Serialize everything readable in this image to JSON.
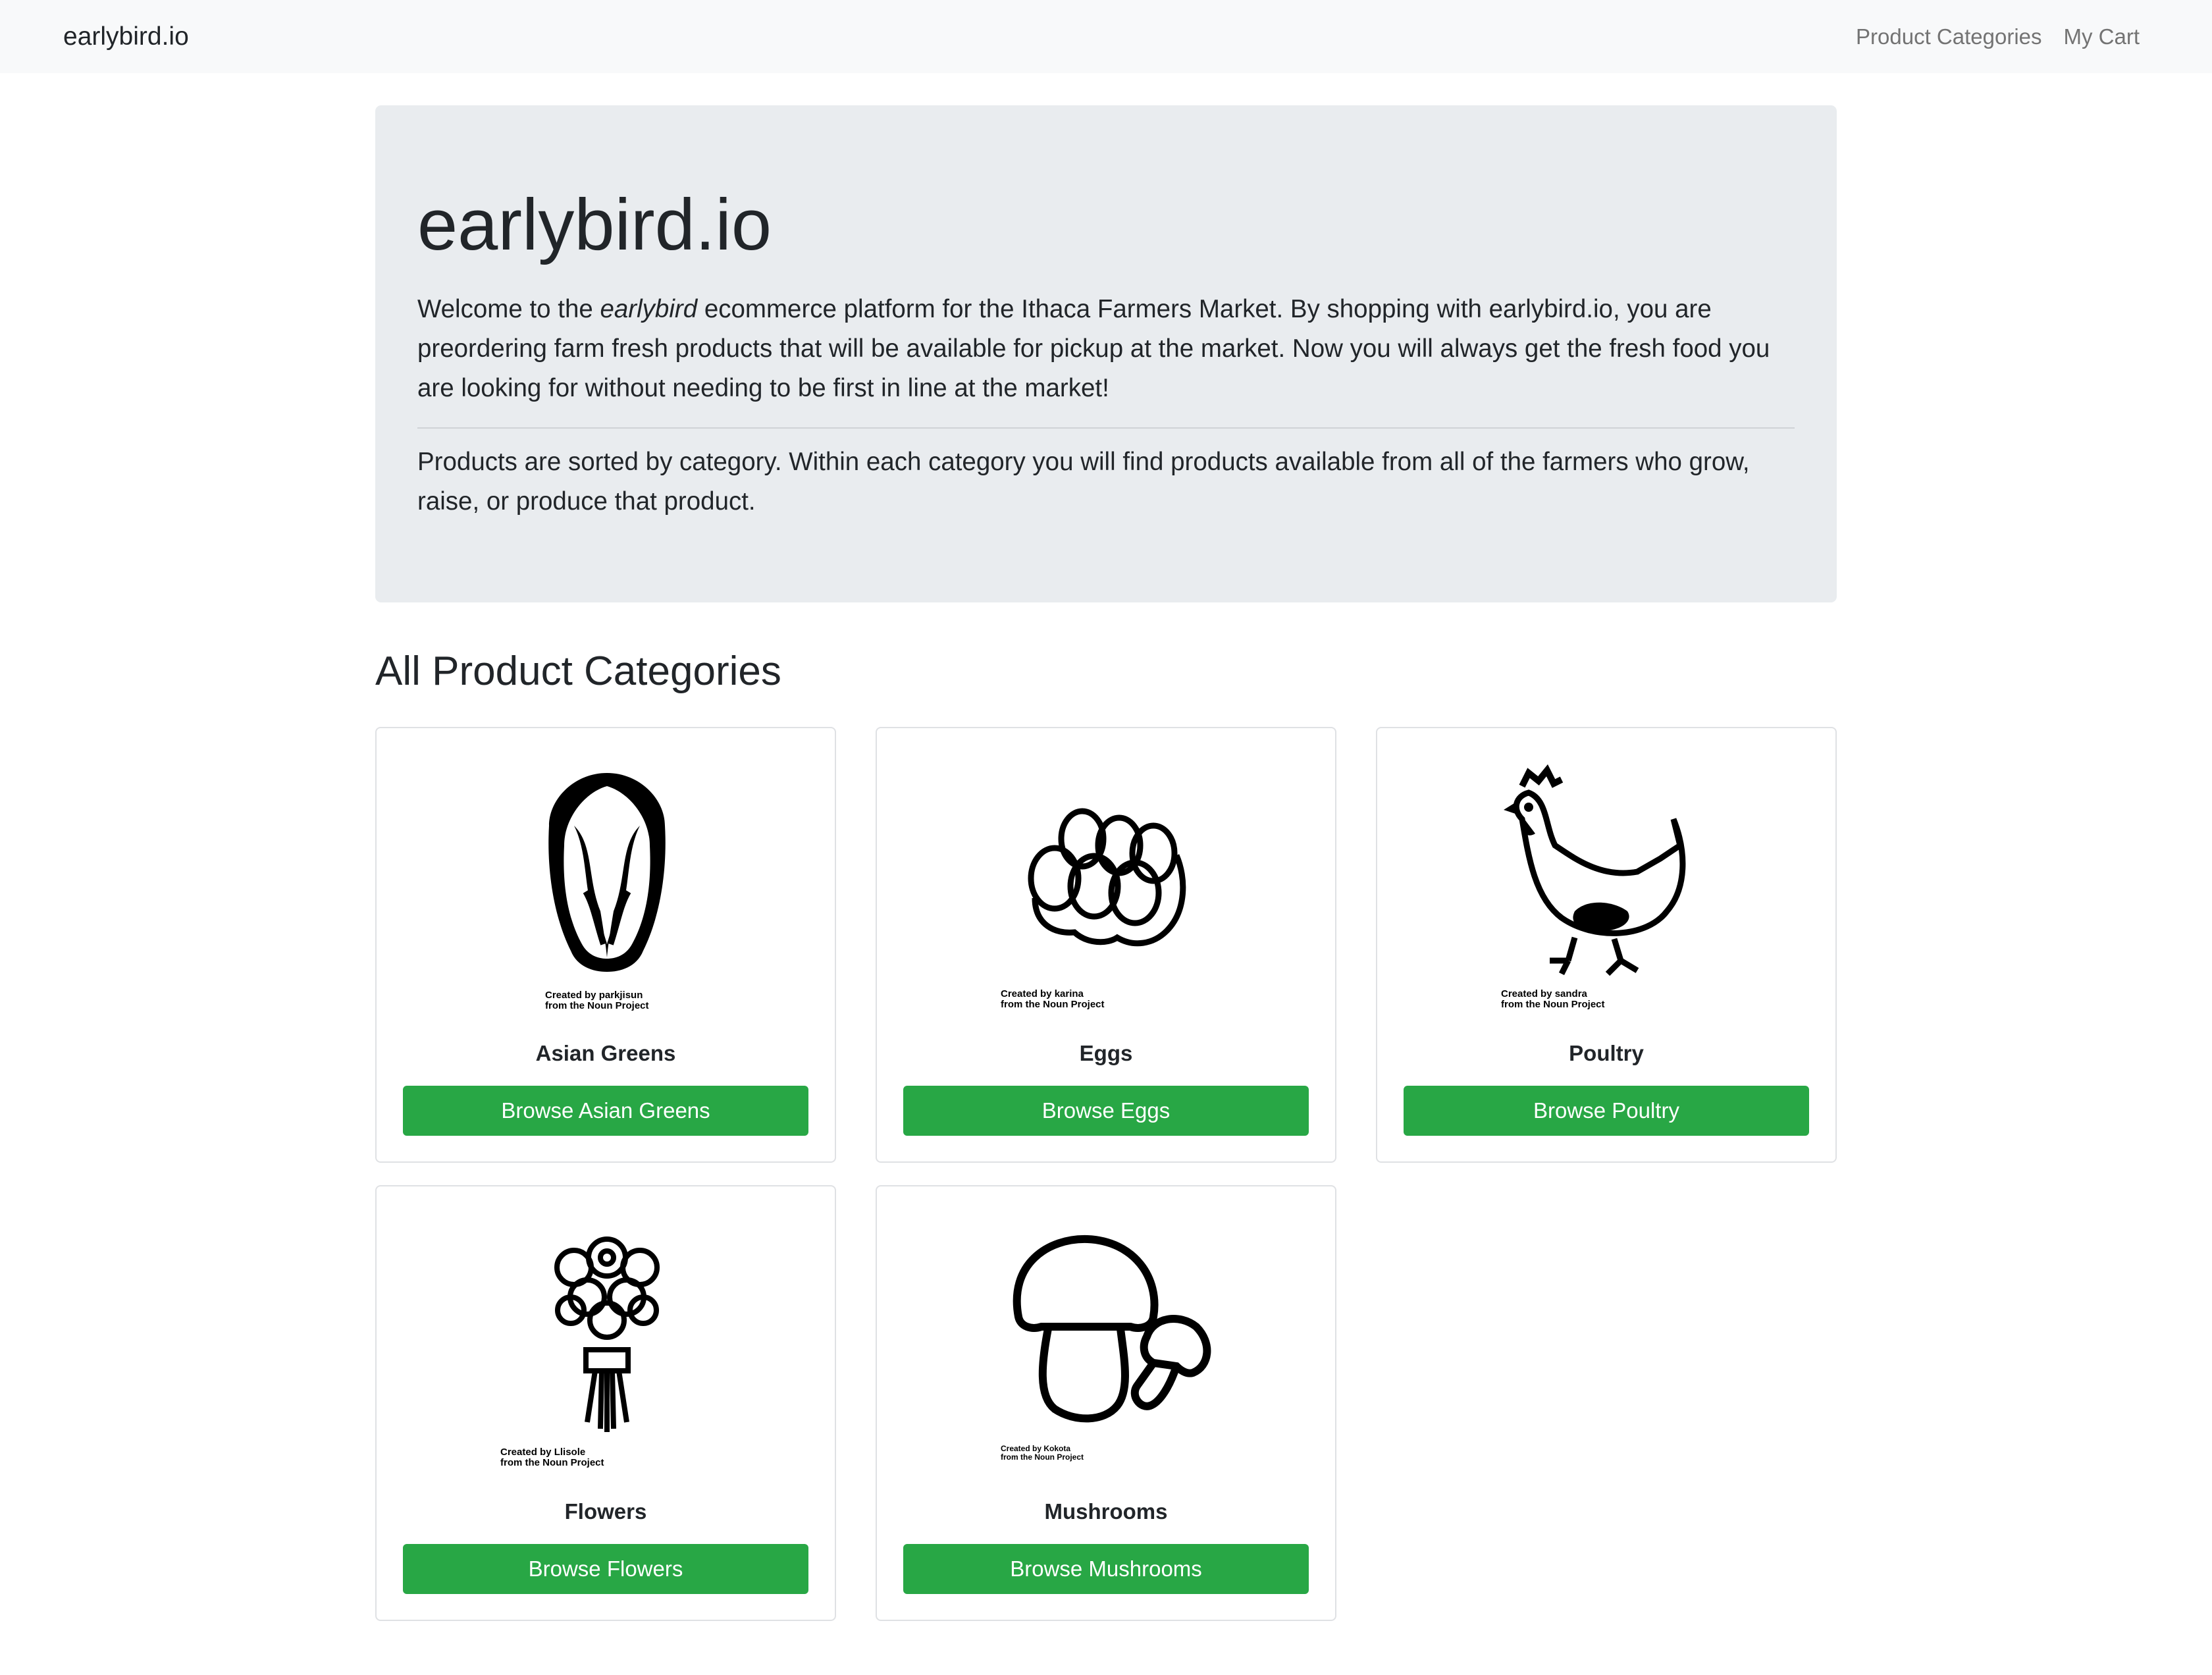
{
  "navbar": {
    "brand": "earlybird.io",
    "links": [
      "Product Categories",
      "My Cart"
    ]
  },
  "jumbotron": {
    "title": "earlybird.io",
    "lead1_pre": "Welcome to the ",
    "lead1_em": "earlybird",
    "lead1_post": " ecommerce platform for the Ithaca Farmers Market. By shopping with earlybird.io, you are preordering farm fresh products that will be available for pickup at the market. Now you will always get the fresh food you are looking for without needing to be first in line at the market!",
    "lead2": "Products are sorted by category. Within each category you will find products available from all of the farmers who grow, raise, or produce that product."
  },
  "section_title": "All Product Categories",
  "categories": [
    {
      "name": "Asian Greens",
      "button": "Browse Asian Greens",
      "credit1": "Created by parkjisun",
      "credit2": "from the Noun Project",
      "icon": "cabbage-icon"
    },
    {
      "name": "Eggs",
      "button": "Browse Eggs",
      "credit1": "Created by karina",
      "credit2": "from the Noun Project",
      "icon": "eggs-icon"
    },
    {
      "name": "Poultry",
      "button": "Browse Poultry",
      "credit1": "Created by sandra",
      "credit2": "from the Noun Project",
      "icon": "chicken-icon"
    },
    {
      "name": "Flowers",
      "button": "Browse Flowers",
      "credit1": "Created by Llisole",
      "credit2": "from the Noun Project",
      "icon": "flowers-icon"
    },
    {
      "name": "Mushrooms",
      "button": "Browse Mushrooms",
      "credit1": "Created by Kokota",
      "credit2": "from the Noun Project",
      "icon": "mushroom-icon"
    }
  ],
  "colors": {
    "navbar_bg": "#f8f9fa",
    "jumbotron_bg": "#e9ecef",
    "button_green": "#28a745"
  }
}
